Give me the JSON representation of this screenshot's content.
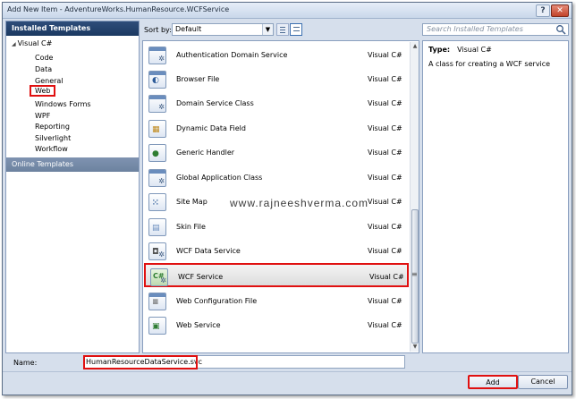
{
  "window": {
    "title": "Add New Item - AdventureWorks.HumanResource.WCFService",
    "help_label": "?",
    "close_label": "✕"
  },
  "left_panel": {
    "installed_header": "Installed Templates",
    "root_label": "Visual C#",
    "items": [
      "Code",
      "Data",
      "General",
      "Web",
      "Windows Forms",
      "WPF",
      "Reporting",
      "Silverlight",
      "Workflow"
    ],
    "selected_item": "Web",
    "online_header": "Online Templates"
  },
  "toolbar": {
    "sort_label": "Sort by:",
    "sort_value": "Default",
    "search_placeholder": "Search Installed Templates"
  },
  "templates": [
    {
      "name": "Authentication Domain Service",
      "lang": "Visual C#",
      "icon": "domain-service-icon"
    },
    {
      "name": "Browser File",
      "lang": "Visual C#",
      "icon": "browser-file-icon"
    },
    {
      "name": "Domain Service Class",
      "lang": "Visual C#",
      "icon": "domain-service-class-icon"
    },
    {
      "name": "Dynamic Data Field",
      "lang": "Visual C#",
      "icon": "dynamic-data-field-icon"
    },
    {
      "name": "Generic Handler",
      "lang": "Visual C#",
      "icon": "generic-handler-icon"
    },
    {
      "name": "Global Application Class",
      "lang": "Visual C#",
      "icon": "global-application-class-icon"
    },
    {
      "name": "Site Map",
      "lang": "Visual C#",
      "icon": "site-map-icon"
    },
    {
      "name": "Skin File",
      "lang": "Visual C#",
      "icon": "skin-file-icon"
    },
    {
      "name": "WCF Data Service",
      "lang": "Visual C#",
      "icon": "wcf-data-service-icon"
    },
    {
      "name": "WCF Service",
      "lang": "Visual C#",
      "icon": "wcf-service-icon"
    },
    {
      "name": "Web Configuration File",
      "lang": "Visual C#",
      "icon": "web-config-icon"
    },
    {
      "name": "Web Service",
      "lang": "Visual C#",
      "icon": "web-service-icon"
    }
  ],
  "selected_template": "WCF Service",
  "details": {
    "type_label": "Type:",
    "type_value": "Visual C#",
    "description": "A class for creating a WCF service"
  },
  "watermark": "www.rajneeshverma.com",
  "footer": {
    "name_label": "Name:",
    "name_value": "HumanResourceDataService.svc",
    "add_label": "Add",
    "cancel_label": "Cancel"
  },
  "colors": {
    "accent_red": "#e01010",
    "header_blue": "#1b3961",
    "dialog_bg": "#d6dfec"
  }
}
